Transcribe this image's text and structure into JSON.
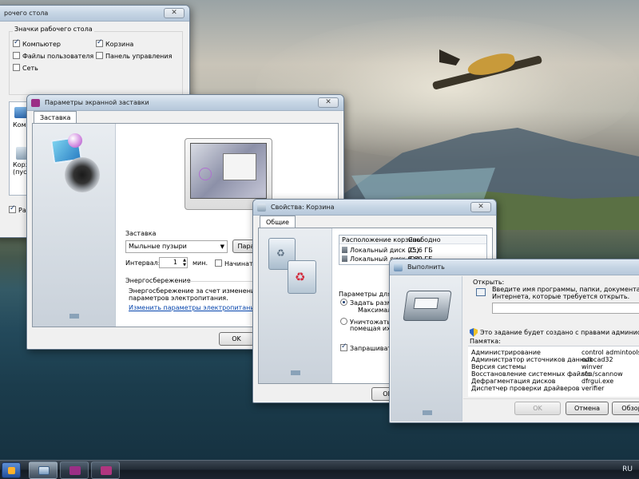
{
  "colors": {
    "taskbar": "#1c2430",
    "link": "#0645ad",
    "titlebar": "#c4d4e4",
    "screensaver_icon": "#9b2f86"
  },
  "desktop_icons_window": {
    "title": "рочего стола",
    "group_title": "Значки рабочего стола",
    "checkboxes": [
      {
        "label": "Компьютер",
        "checked": true
      },
      {
        "label": "Корзина",
        "checked": true
      },
      {
        "label": "Файлы пользователя",
        "checked": false
      },
      {
        "label": "Панель управления",
        "checked": false
      },
      {
        "label": "Сеть",
        "checked": false
      }
    ],
    "partial_icon_labels": [
      "Компь",
      "Корзи",
      "(пуст"
    ],
    "bottom_check_label": "Разр"
  },
  "screensaver_window": {
    "title": "Параметры экранной заставки",
    "tab": "Заставка",
    "group_title": "Заставка",
    "selected_screensaver": "Мыльные пузыри",
    "params_button": "Парам",
    "interval_label": "Интервал:",
    "interval_value": "1",
    "interval_unit": "мин.",
    "start_check_label": "Начинать с",
    "power_group_title": "Энергосбережение",
    "power_text_1": "Энергосбережение за счет изменения яркости",
    "power_text_2": "параметров электропитания.",
    "power_link": "Изменить параметры электропитания...",
    "ok_button": "OK"
  },
  "recycle_window": {
    "title": "Свойства: Корзина",
    "tab": "Общие",
    "col_location": "Расположение корзины",
    "col_free": "Свободно",
    "rows": [
      {
        "location": "Локальный диск (C:)",
        "free": "25,6 ГБ"
      },
      {
        "location": "Локальный диск (D:)",
        "free": "6,89 ГБ"
      }
    ],
    "params_label": "Параметры для вы",
    "radio_1": "Задать размер:",
    "radio_1_sub": "Максимальн",
    "radio_2": "Уничтожать фай",
    "radio_2_sub": "помещая их в",
    "confirm_check": "Запрашивать по",
    "ok_button": "OK"
  },
  "run_window": {
    "title": "Выполнить",
    "open_label": "Открыть:",
    "hint_1": "Введите имя программы, папки, документа или ресу",
    "hint_2": "Интернета, которые требуется открыть.",
    "admin_note": "Это задание будет создано с правами администратора",
    "memo_title": "Памятка:",
    "memo_rows": [
      {
        "name": "Администрирование",
        "cmd": "control admintools"
      },
      {
        "name": "Администратор источников данных",
        "cmd": "odbcad32"
      },
      {
        "name": "Версия системы",
        "cmd": "winver"
      },
      {
        "name": "Восстановление системных файлов",
        "cmd": "sfc /scannow"
      },
      {
        "name": "Дефрагментация дисков",
        "cmd": "dfrgui.exe"
      },
      {
        "name": "Диспетчер проверки драйверов",
        "cmd": "verifier"
      }
    ],
    "ok_button": "OK",
    "cancel_button": "Отмена",
    "browse_button": "Обзор"
  },
  "taskbar": {
    "language": "RU"
  }
}
